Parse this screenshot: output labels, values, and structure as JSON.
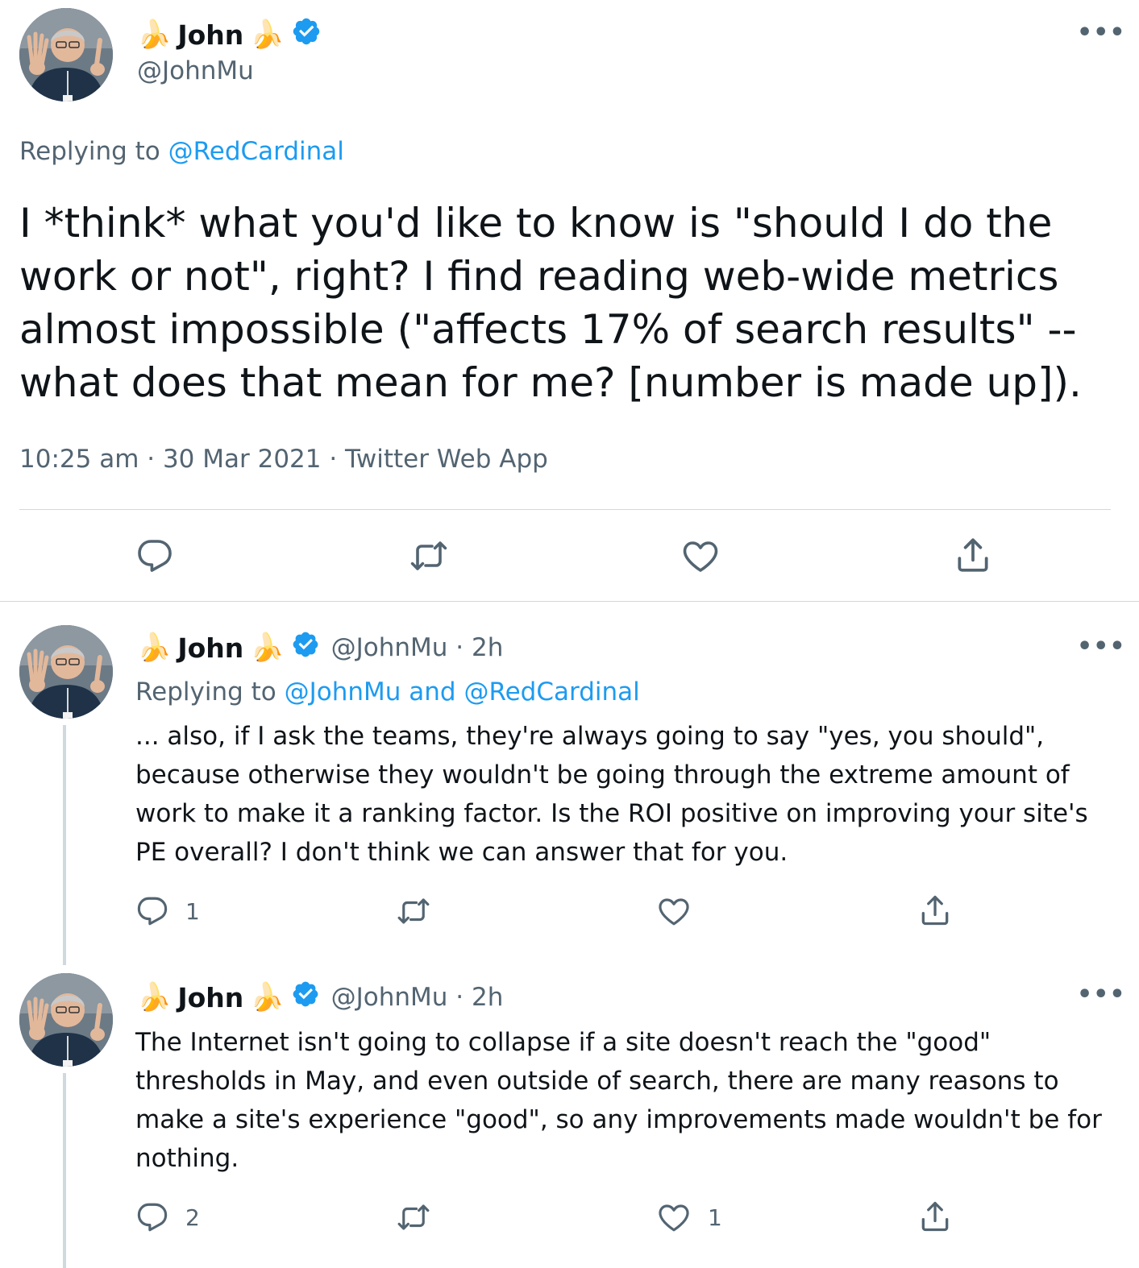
{
  "main_tweet": {
    "display_name": "John",
    "handle": "@JohnMu",
    "replying_prefix": "Replying to ",
    "replying_to": "@RedCardinal",
    "text": "I *think* what you'd like to know is \"should I do the work or not\", right? I find reading web-wide metrics almost impossible (\"affects 17% of search results\" -- what does that mean for me? [number is made up]).",
    "timestamp": "10:25 am · 30 Mar 2021 · Twitter Web App"
  },
  "reply_1": {
    "display_name": "John",
    "handle_time": "@JohnMu · 2h",
    "replying_prefix": "Replying to ",
    "replying_to": "@JohnMu and @RedCardinal",
    "text": "... also, if I ask the teams, they're always going to say \"yes, you should\", because otherwise they wouldn't be going through the extreme amount of work to make it a ranking factor. Is the ROI positive on improving your site's PE overall? I don't think we can answer that for you.",
    "reply_count": "1",
    "like_count": ""
  },
  "reply_2": {
    "display_name": "John",
    "handle_time": "@JohnMu · 2h",
    "text": "The Internet isn't going to collapse if a site doesn't reach the \"good\" thresholds in May, and even outside of search, there are many reasons to make a site's experience \"good\", so any improvements made wouldn't be for nothing.",
    "reply_count": "2",
    "like_count": "1"
  },
  "icons": {
    "name_emoji": "banana",
    "verified": "verified-badge-icon",
    "more": "more-icon",
    "reply": "reply-icon",
    "retweet": "retweet-icon",
    "like": "like-icon",
    "share": "share-icon"
  },
  "colors": {
    "link": "#1d9bf0",
    "muted": "#536471",
    "text": "#0f1419",
    "divider": "#cfd9de"
  }
}
